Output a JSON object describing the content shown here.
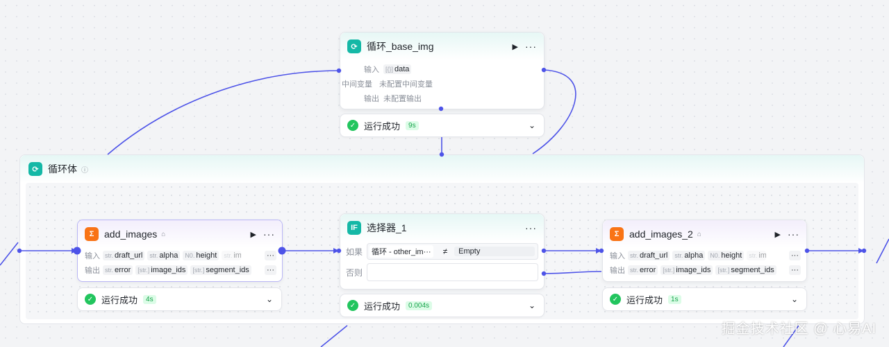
{
  "loop_node": {
    "title": "循环_base_img",
    "icon": "loop-icon",
    "input_label": "输入",
    "input_type": "[{}]",
    "input_value": "data",
    "mid_label": "中间变量",
    "mid_value": "未配置中间变量",
    "output_label": "输出",
    "output_value": "未配置输出",
    "status_text": "运行成功",
    "status_time": "9s"
  },
  "loop_body": {
    "title": "循环体",
    "info_icon": "ⓘ"
  },
  "add_images": {
    "title": "add_images",
    "icon": "add-images-icon",
    "input_label": "输入",
    "inputs": [
      {
        "type": "str.",
        "name": "draft_url"
      },
      {
        "type": "str.",
        "name": "alpha"
      },
      {
        "type": "N0.",
        "name": "height"
      },
      {
        "type": "str.",
        "name": "ima"
      }
    ],
    "output_label": "输出",
    "outputs": [
      {
        "type": "str.",
        "name": "error"
      },
      {
        "type": "[str.]",
        "name": "image_ids"
      },
      {
        "type": "[str.]",
        "name": "segment_ids"
      }
    ],
    "more": "···",
    "status_text": "运行成功",
    "status_time": "4s"
  },
  "selector": {
    "title": "选择器_1",
    "icon": "IF",
    "if_label": "如果",
    "cond_left": "循环 - other_im···",
    "cond_op": "≠",
    "cond_right": "Empty",
    "else_label": "否则",
    "status_text": "运行成功",
    "status_time": "0.004s"
  },
  "add_images_2": {
    "title": "add_images_2",
    "icon": "add-images-icon",
    "input_label": "输入",
    "inputs": [
      {
        "type": "str.",
        "name": "draft_url"
      },
      {
        "type": "str.",
        "name": "alpha"
      },
      {
        "type": "N0.",
        "name": "height"
      },
      {
        "type": "str.",
        "name": "ima"
      }
    ],
    "output_label": "输出",
    "outputs": [
      {
        "type": "str.",
        "name": "error"
      },
      {
        "type": "[str.]",
        "name": "image_ids"
      },
      {
        "type": "[str.]",
        "name": "segment_ids"
      }
    ],
    "more": "···",
    "status_text": "运行成功",
    "status_time": "1s"
  },
  "watermark": "掘金技术社区 @ 心易AI",
  "colors": {
    "wire": "#4d53e8",
    "success": "#22c55e",
    "teal_icon": "#14b8a6",
    "orange_icon": "#f97316"
  }
}
